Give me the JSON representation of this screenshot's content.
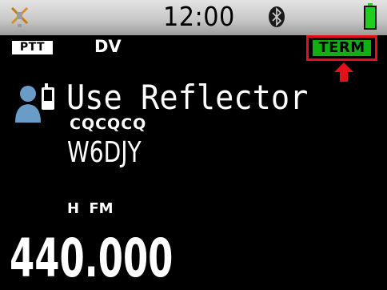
{
  "status_bar": {
    "time": "12:00",
    "gps_icon": "gps-satellite-icon",
    "bluetooth_icon": "bluetooth-icon",
    "battery_icon": "battery-icon",
    "battery_level": 1.0,
    "battery_color": "#22cc22"
  },
  "indicators": {
    "ptt_label": "PTT",
    "mode_label": "DV",
    "term_label": "TERM",
    "term_color": "#10b010",
    "highlight_color": "#e4101a",
    "arrow_icon": "red-up-arrow-icon"
  },
  "contact": {
    "icon": "contact-person-icon",
    "reflector_text": "Use Reflector",
    "urcall": "CQCQCQ",
    "callsign": "W6DJY"
  },
  "power_mode": "H FM",
  "frequency": "440.000"
}
